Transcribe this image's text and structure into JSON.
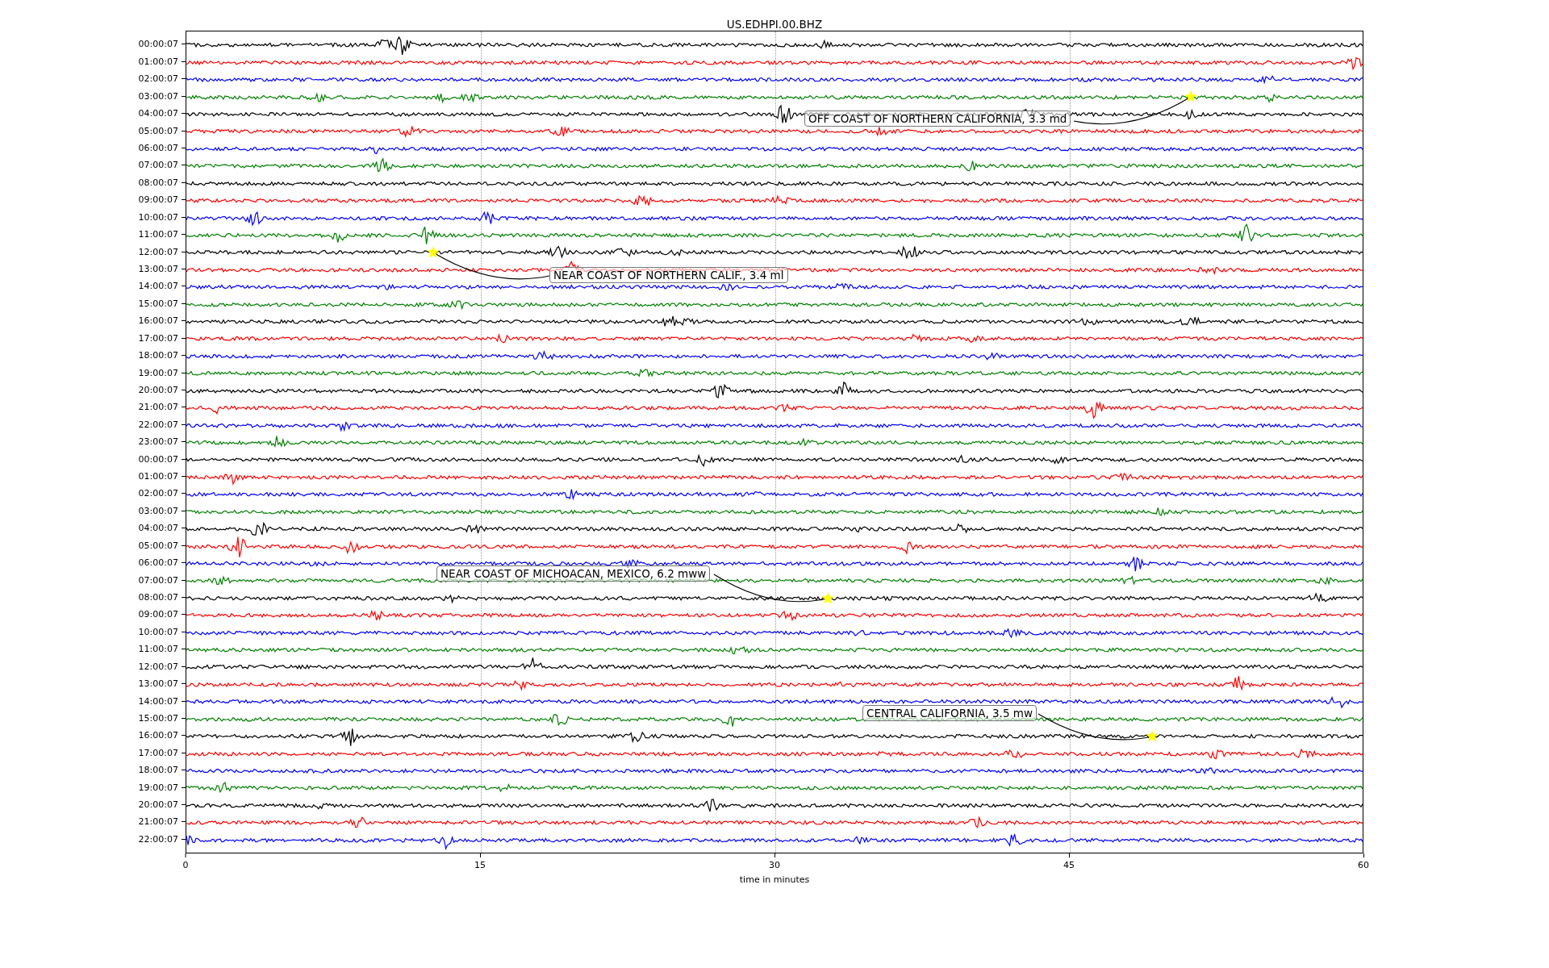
{
  "title": "US.EDHPI.00.BHZ",
  "traces": [
    {
      "label": "00:00:07",
      "color": "#000000"
    },
    {
      "label": "01:00:07",
      "color": "#ff0000"
    },
    {
      "label": "02:00:07",
      "color": "#0000ff"
    },
    {
      "label": "03:00:07",
      "color": "#008000"
    },
    {
      "label": "04:00:07",
      "color": "#000000"
    },
    {
      "label": "05:00:07",
      "color": "#ff0000"
    },
    {
      "label": "06:00:07",
      "color": "#0000ff"
    },
    {
      "label": "07:00:07",
      "color": "#008000"
    },
    {
      "label": "08:00:07",
      "color": "#000000"
    },
    {
      "label": "09:00:07",
      "color": "#ff0000"
    },
    {
      "label": "10:00:07",
      "color": "#0000ff"
    },
    {
      "label": "11:00:07",
      "color": "#008000"
    },
    {
      "label": "12:00:07",
      "color": "#000000"
    },
    {
      "label": "13:00:07",
      "color": "#ff0000"
    },
    {
      "label": "14:00:07",
      "color": "#0000ff"
    },
    {
      "label": "15:00:07",
      "color": "#008000"
    },
    {
      "label": "16:00:07",
      "color": "#000000"
    },
    {
      "label": "17:00:07",
      "color": "#ff0000"
    },
    {
      "label": "18:00:07",
      "color": "#0000ff"
    },
    {
      "label": "19:00:07",
      "color": "#008000"
    },
    {
      "label": "20:00:07",
      "color": "#000000"
    },
    {
      "label": "21:00:07",
      "color": "#ff0000"
    },
    {
      "label": "22:00:07",
      "color": "#0000ff"
    },
    {
      "label": "23:00:07",
      "color": "#008000"
    },
    {
      "label": "00:00:07",
      "color": "#000000"
    },
    {
      "label": "01:00:07",
      "color": "#ff0000"
    },
    {
      "label": "02:00:07",
      "color": "#0000ff"
    },
    {
      "label": "03:00:07",
      "color": "#008000"
    },
    {
      "label": "04:00:07",
      "color": "#000000"
    },
    {
      "label": "05:00:07",
      "color": "#ff0000"
    },
    {
      "label": "06:00:07",
      "color": "#0000ff"
    },
    {
      "label": "07:00:07",
      "color": "#008000"
    },
    {
      "label": "08:00:07",
      "color": "#000000"
    },
    {
      "label": "09:00:07",
      "color": "#ff0000"
    },
    {
      "label": "10:00:07",
      "color": "#0000ff"
    },
    {
      "label": "11:00:07",
      "color": "#008000"
    },
    {
      "label": "12:00:07",
      "color": "#000000"
    },
    {
      "label": "13:00:07",
      "color": "#ff0000"
    },
    {
      "label": "14:00:07",
      "color": "#0000ff"
    },
    {
      "label": "15:00:07",
      "color": "#008000"
    },
    {
      "label": "16:00:07",
      "color": "#000000"
    },
    {
      "label": "17:00:07",
      "color": "#ff0000"
    },
    {
      "label": "18:00:07",
      "color": "#0000ff"
    },
    {
      "label": "19:00:07",
      "color": "#008000"
    },
    {
      "label": "20:00:07",
      "color": "#000000"
    },
    {
      "label": "21:00:07",
      "color": "#ff0000"
    },
    {
      "label": "22:00:07",
      "color": "#0000ff"
    }
  ],
  "x_ticks": [
    "0",
    "15",
    "30",
    "45",
    "60"
  ],
  "xlabel": "time in minutes",
  "annotations": [
    {
      "text": "OFF COAST OF NORTHERN CALIFORNIA, 3.3 md"
    },
    {
      "text": "NEAR COAST OF NORTHERN CALIF., 3.4 ml"
    },
    {
      "text": "NEAR COAST OF MICHOACAN, MEXICO, 6.2 mww"
    },
    {
      "text": "CENTRAL CALIFORNIA, 3.5 mw"
    }
  ]
}
